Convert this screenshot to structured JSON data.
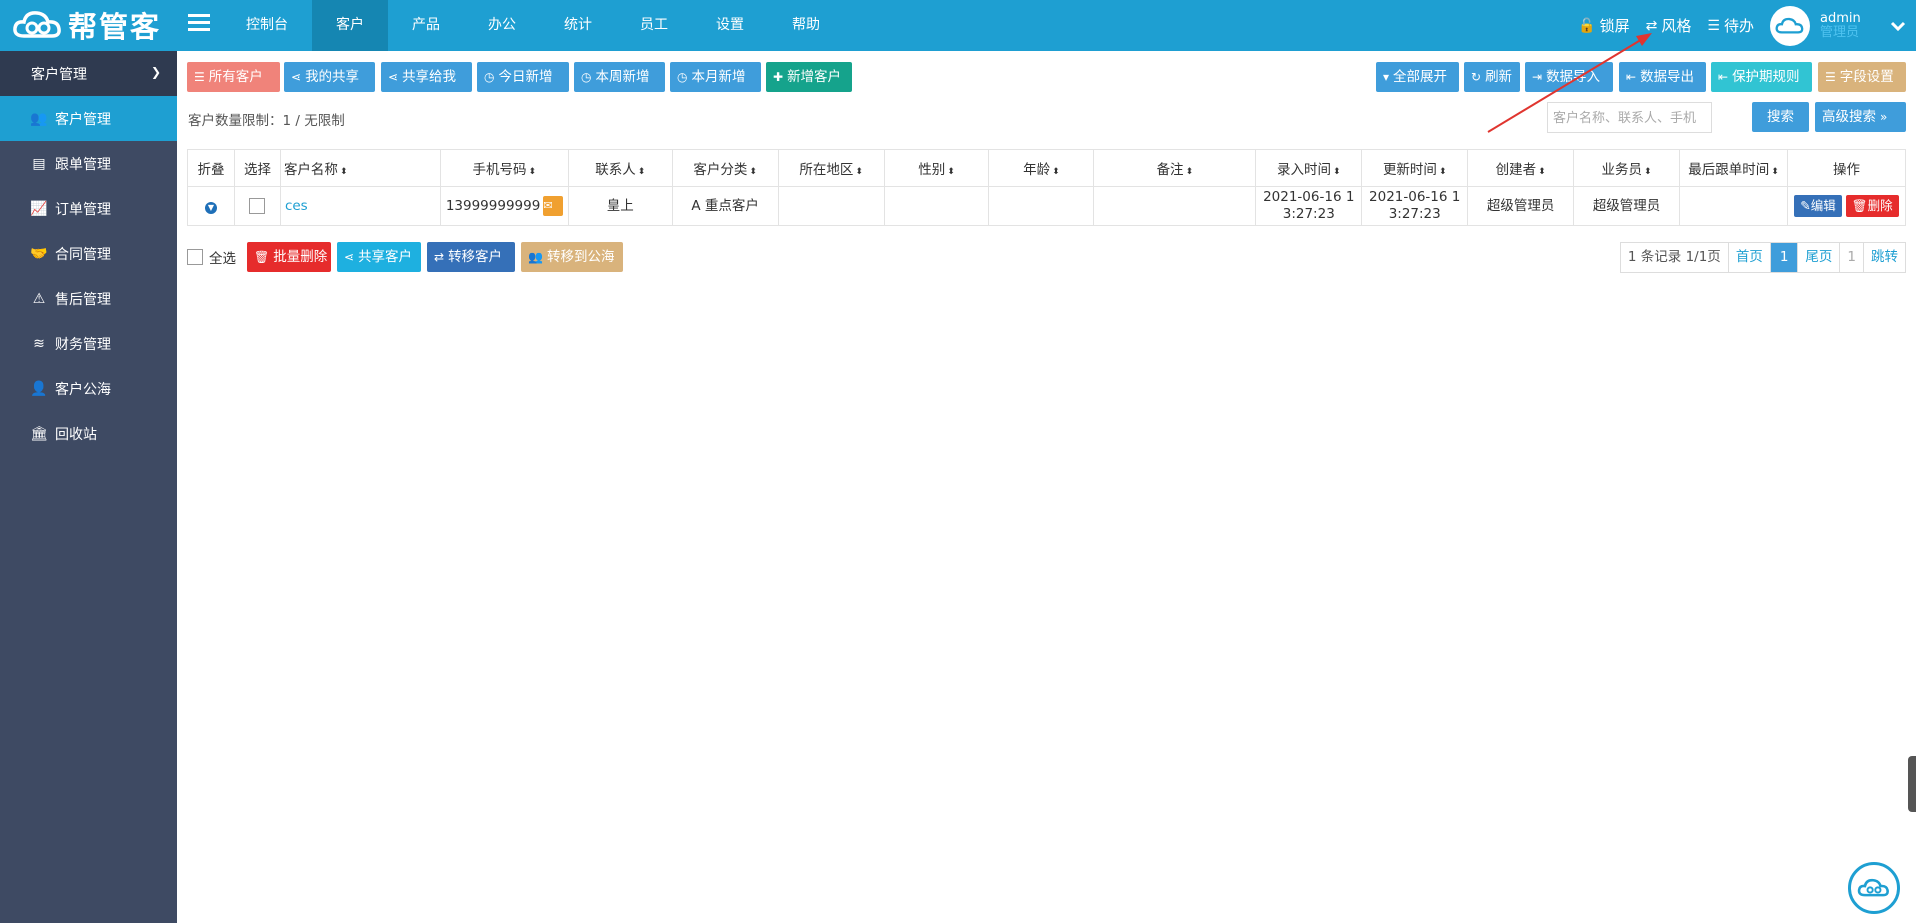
{
  "app": {
    "logo_text": "帮管客"
  },
  "topnav": [
    "控制台",
    "客户",
    "产品",
    "办公",
    "统计",
    "员工",
    "设置",
    "帮助"
  ],
  "top_right": {
    "lock": "锁屏",
    "style": "风格",
    "todo": "待办",
    "admin_name": "admin",
    "admin_role": "管理员"
  },
  "sidebar": {
    "header": "客户管理",
    "items": [
      "客户管理",
      "跟单管理",
      "订单管理",
      "合同管理",
      "售后管理",
      "财务管理",
      "客户公海",
      "回收站"
    ]
  },
  "toolbar": {
    "all_customers": "所有客户",
    "my_share": "我的共享",
    "shared_to_me": "共享给我",
    "today_new": "今日新增",
    "week_new": "本周新增",
    "month_new": "本月新增",
    "add_customer": "新增客户",
    "expand_all": "全部展开",
    "refresh": "刷新",
    "import": "数据导入",
    "export": "数据导出",
    "protect_rule": "保护期规则",
    "field_settings": "字段设置"
  },
  "limit_text": "客户数量限制：1 / 无限制",
  "search": {
    "placeholder": "客户名称、联系人、手机",
    "search_btn": "搜索",
    "advanced_btn": "高级搜索"
  },
  "table": {
    "headers": [
      "折叠",
      "选择",
      "客户名称",
      "手机号码",
      "联系人",
      "客户分类",
      "所在地区",
      "性别",
      "年龄",
      "备注",
      "录入时间",
      "更新时间",
      "创建者",
      "业务员",
      "最后跟单时间",
      "操作"
    ],
    "rows": [
      {
        "name": "ces",
        "phone": "13999999999",
        "contact": "皇上",
        "category": "A 重点客户",
        "region": "",
        "gender": "",
        "age": "",
        "note": "",
        "created_l1": "2021-06-16 1",
        "created_l2": "3:27:23",
        "updated_l1": "2021-06-16 1",
        "updated_l2": "3:27:23",
        "creator": "超级管理员",
        "salesman": "超级管理员",
        "last_follow": "",
        "edit": "编辑",
        "delete": "删除"
      }
    ]
  },
  "bulk": {
    "select_all": "全选",
    "batch_delete": "批量删除",
    "share": "共享客户",
    "transfer": "转移客户",
    "to_pool": "转移到公海"
  },
  "pager": {
    "summary": "1 条记录 1/1页",
    "first": "首页",
    "current": "1",
    "last": "尾页",
    "jump_value": "1",
    "jump": "跳转"
  },
  "colors": {
    "brand": "#1e9fd2",
    "sidebar": "#3e4a63",
    "danger": "#e62c2c",
    "arrow": "#e0352f"
  }
}
